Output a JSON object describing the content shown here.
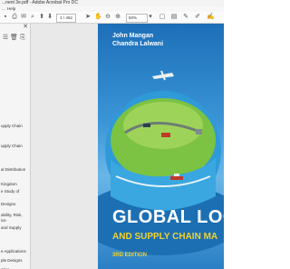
{
  "window": {
    "title": "...nent 3e.pdf - Adobe Acrobat Pro DC"
  },
  "menu": {
    "items": [
      "...",
      "Help"
    ]
  },
  "toolbar": {
    "page_indicator": "1 / 462",
    "zoom": "50%"
  },
  "sidebar": {
    "items": [
      "upply Chain",
      "upply Chain",
      "al Distribution",
      "Kingdom",
      "e Study of",
      "Designs",
      "ability, Risk,",
      "ice",
      "and Supply",
      "e Applications",
      "ple Designs",
      "ative"
    ]
  },
  "cover": {
    "author_1": "John Mangan",
    "author_2": "Chandra Lalwani",
    "title_main": "GLOBAL LOGI",
    "title_sub": "AND SUPPLY CHAIN MA",
    "edition": "3RD EDITION"
  },
  "colors": {
    "cover_blue": "#2a86cc",
    "cover_yellow": "#f2d22e",
    "globe_green": "#6cb437"
  }
}
